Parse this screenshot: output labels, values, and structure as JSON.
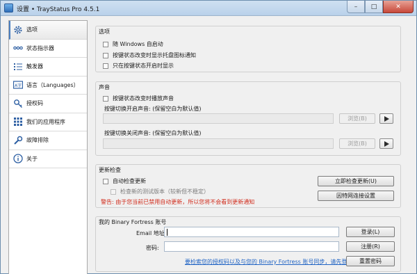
{
  "window": {
    "title": "设置 • TrayStatus Pro 4.5.1"
  },
  "sidebar": {
    "items": [
      {
        "label": "选项",
        "icon": "gear-icon"
      },
      {
        "label": "状态指示器",
        "icon": "dots-icon"
      },
      {
        "label": "触发器",
        "icon": "list-icon"
      },
      {
        "label": "语言（Languages）",
        "icon": "language-icon"
      },
      {
        "label": "授权码",
        "icon": "key-icon"
      },
      {
        "label": "我们的应用程序",
        "icon": "apps-icon"
      },
      {
        "label": "故障排除",
        "icon": "wrench-icon"
      },
      {
        "label": "关于",
        "icon": "info-icon"
      }
    ]
  },
  "options": {
    "title": "选项",
    "run_on_startup": "随 Windows 自启动",
    "show_tray_notification": "按键状态改变时显示托盘图标通知",
    "show_only_on": "只在按键状态开启时显示"
  },
  "sound": {
    "title": "声音",
    "play_sound": "按键状态改变时播放声音",
    "on_sound_label": "按键切换开启声音: (保留空白为默认值)",
    "off_sound_label": "按键切换关闭声音: (保留空白为默认值)",
    "browse_label": "浏览(B)"
  },
  "updates": {
    "title": "更新检查",
    "auto_check": "自动检查更新",
    "check_beta": "检查新的测试版本（较新但不稳定）",
    "warning": "警告: 由于您当前已禁用自动更新，所以您将不会看到更新通知",
    "check_now_button": "立即检查更新(U)",
    "proxy_button": "因特网连接设置"
  },
  "account": {
    "title": "我的 Binary Fortress 账号",
    "email_label": "Email 地址:",
    "email_value": "",
    "password_label": "密码:",
    "password_value": "",
    "login_button": "登录(L)",
    "register_button": "注册(R)",
    "sync_link": "要检索您的授权码以及与您的 Binary Fortress 账号同步，请先登录。",
    "reset_button": "重置密码"
  }
}
